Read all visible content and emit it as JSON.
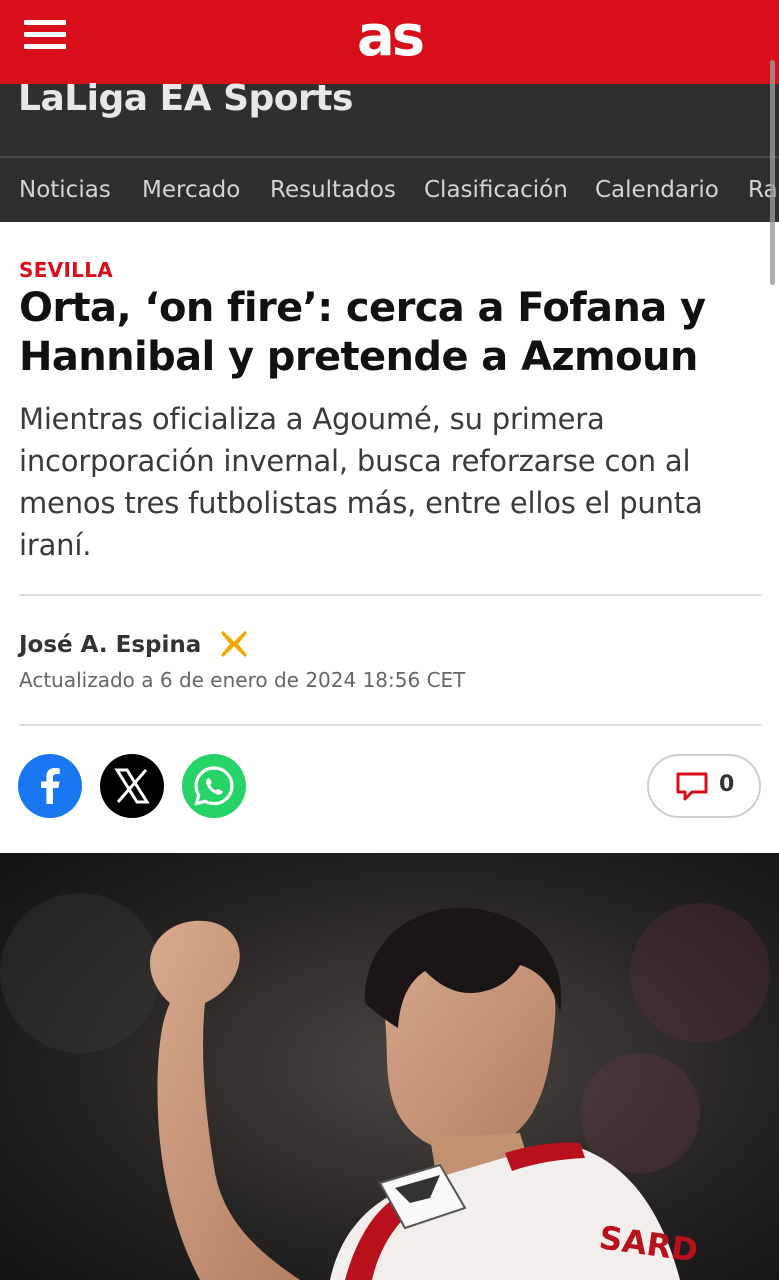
{
  "header": {
    "logo": "as",
    "menu_icon": "hamburger-menu-icon"
  },
  "section": {
    "title": "LaLiga EA Sports"
  },
  "nav": {
    "tabs": [
      "Noticias",
      "Mercado",
      "Resultados",
      "Clasificación",
      "Calendario",
      "Ra"
    ]
  },
  "article": {
    "kicker": "SEVILLA",
    "headline": "Orta, ‘on fire’: cerca a Fofana y Hannibal y pretende a Azmoun",
    "subtitle": "Mientras oficializa a Agoumé, su primera incorporación invernal, busca reforzarse con al menos tres futbolistas más, entre ellos el punta iraní.",
    "author": "José A. Espina",
    "author_social_icon": "x-icon",
    "updated": "Actualizado a 6 de enero de 2024 18:56 CET"
  },
  "share": {
    "facebook_icon": "facebook-icon",
    "x_icon": "x-icon",
    "whatsapp_icon": "whatsapp-icon",
    "comments_count": "0"
  },
  "photo": {
    "jersey_text": "SARD"
  },
  "colors": {
    "brand_red": "#d80e1a",
    "nav_bg": "#2f2f2f",
    "facebook": "#1a77f2",
    "whatsapp": "#25d366",
    "author_x": "#f2a900"
  }
}
